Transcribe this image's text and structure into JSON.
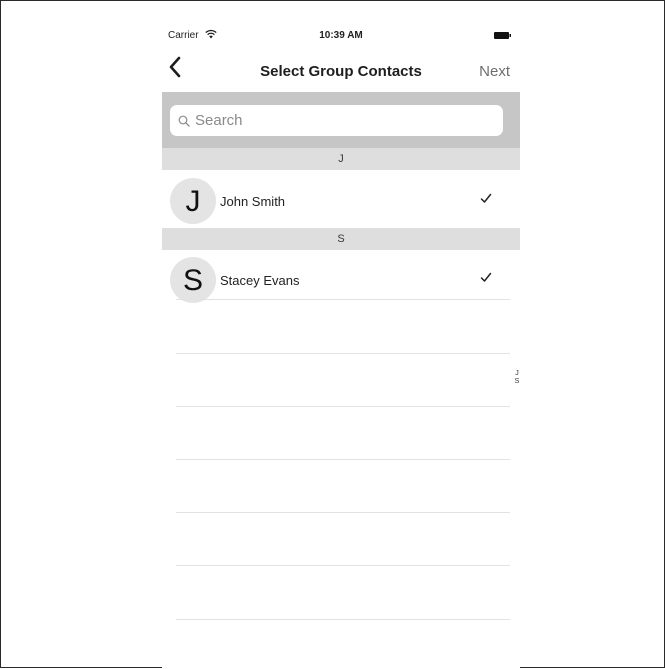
{
  "status_bar": {
    "carrier": "Carrier",
    "time": "10:39 AM"
  },
  "nav_bar": {
    "back_icon": "chevron-left-icon",
    "title": "Select Group Contacts",
    "next_label": "Next"
  },
  "search": {
    "placeholder": "Search",
    "value": ""
  },
  "sections": [
    {
      "header": "J",
      "contacts": [
        {
          "initial": "J",
          "name": "John Smith",
          "selected": true
        }
      ]
    },
    {
      "header": "S",
      "contacts": [
        {
          "initial": "S",
          "name": "Stacey Evans",
          "selected": true
        }
      ]
    }
  ],
  "section_index": [
    "J",
    "S"
  ],
  "colors": {
    "search_band": "#c6c6c6",
    "section_header": "#dedede",
    "avatar_bg": "#e4e4e4",
    "separator": "#e2e2e2"
  }
}
